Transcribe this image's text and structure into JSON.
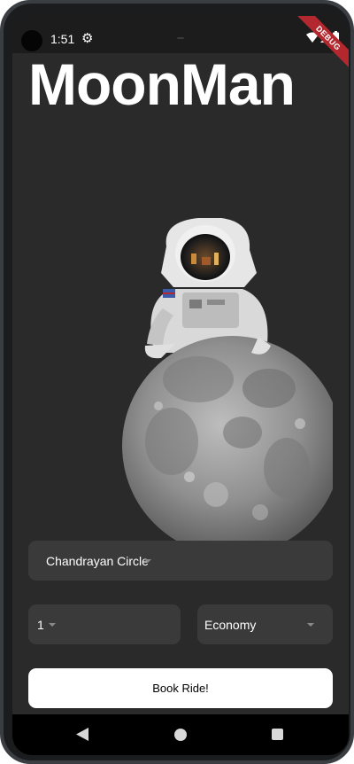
{
  "status_bar": {
    "time": "1:51",
    "icons": [
      "camera-hole",
      "gear-icon",
      "wifi-icon",
      "signal-icon",
      "battery-icon"
    ]
  },
  "debug_banner": "DEBUG",
  "app": {
    "title": "MoonMan"
  },
  "form": {
    "destination": {
      "value": "Chandrayan Circle"
    },
    "passengers": {
      "value": "1"
    },
    "travel_class": {
      "value": "Economy"
    },
    "book_button_label": "Book Ride!"
  },
  "nav_bar": {
    "icons": [
      "back-icon",
      "home-icon",
      "recents-icon"
    ]
  },
  "colors": {
    "background": "#2a2a2a",
    "field": "#3a3a3a",
    "button": "#ffffff",
    "debug": "#b3282f"
  }
}
